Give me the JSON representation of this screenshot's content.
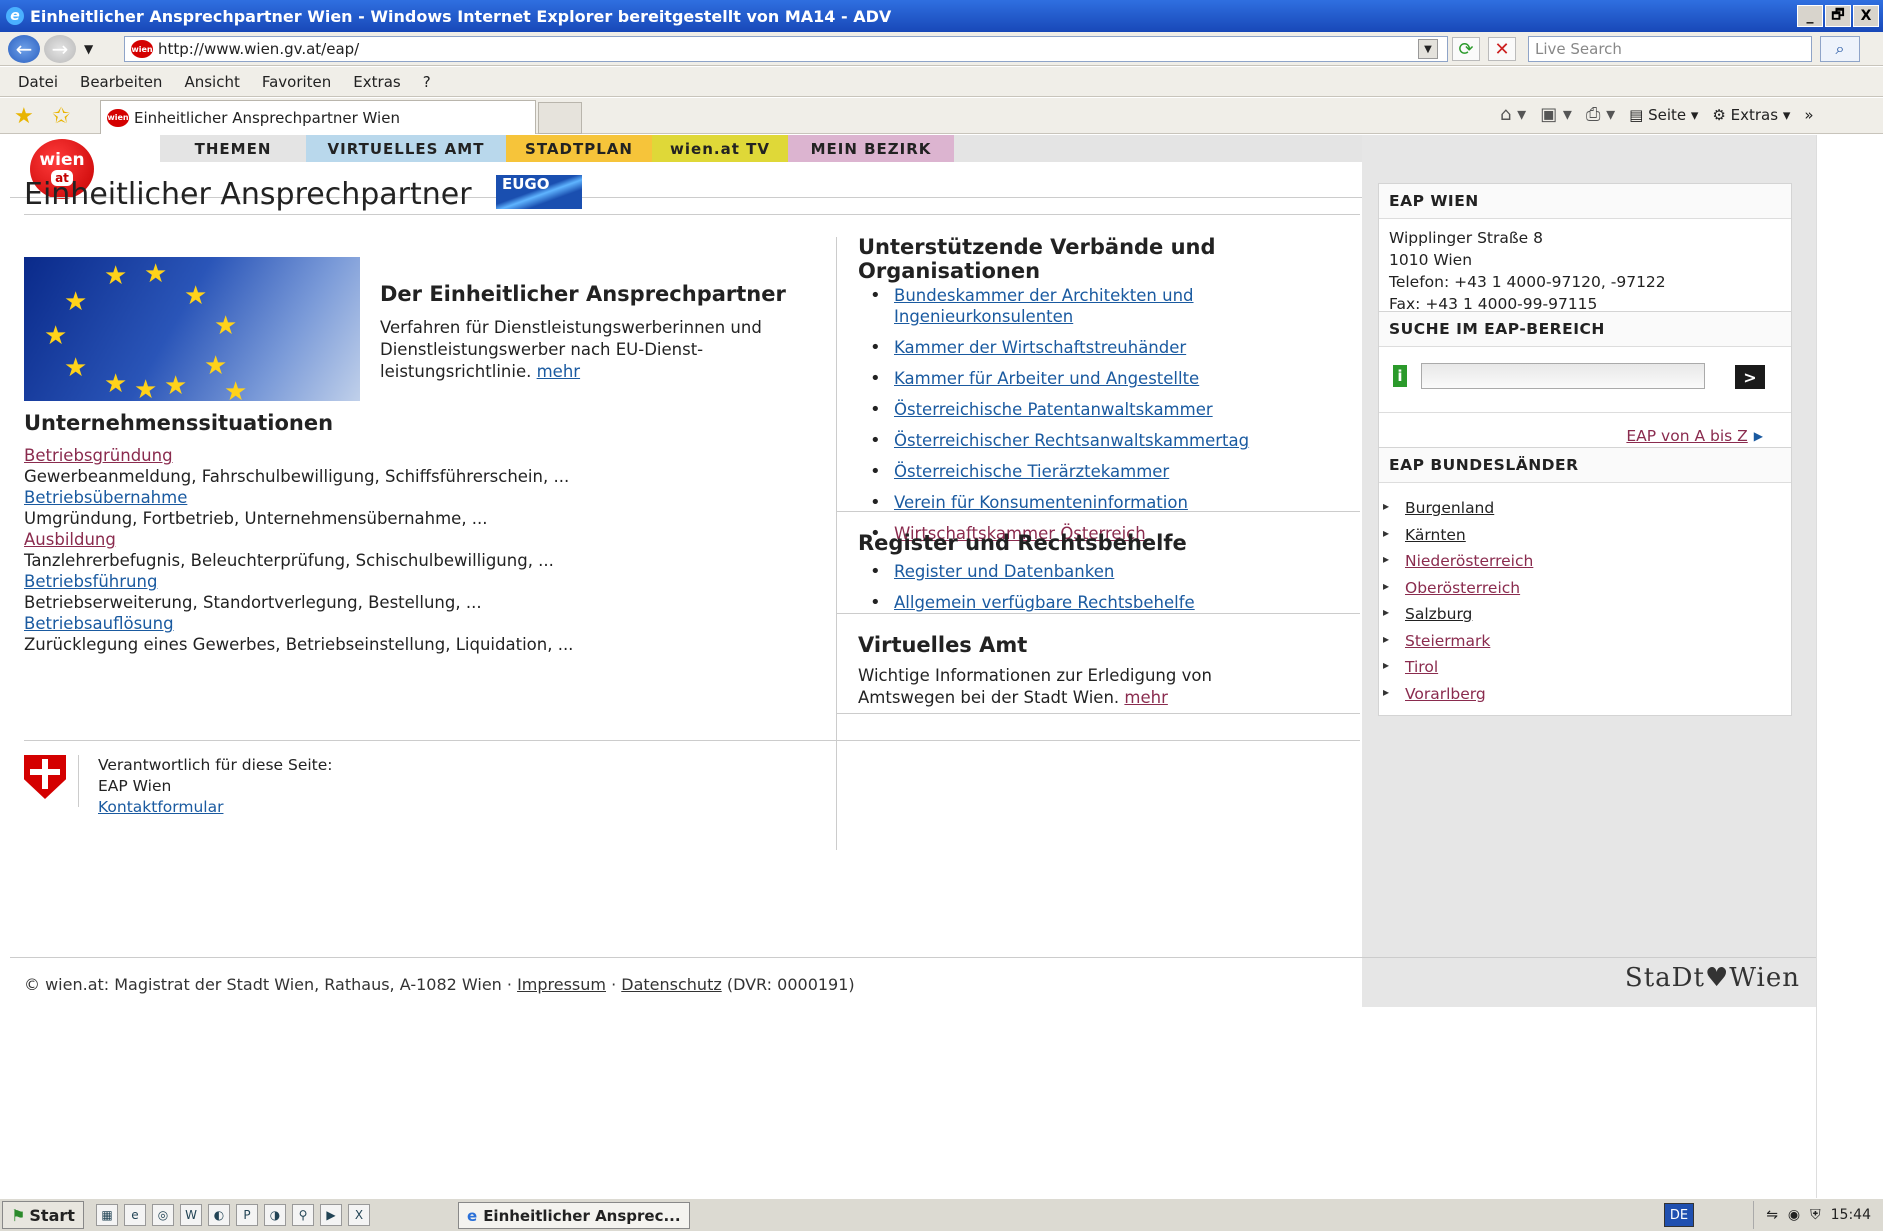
{
  "window": {
    "title": "Einheitlicher Ansprechpartner Wien - Windows Internet Explorer bereitgestellt von MA14 - ADV",
    "minimize": "_",
    "maximize": "🗗",
    "close": "X"
  },
  "browser": {
    "url": "http://www.wien.gv.at/eap/",
    "search_placeholder": "Live Search",
    "menu": [
      "Datei",
      "Bearbeiten",
      "Ansicht",
      "Favoriten",
      "Extras",
      "?"
    ],
    "tab_title": "Einheitlicher Ansprechpartner Wien",
    "cmd": {
      "page": "Seite",
      "extras": "Extras"
    }
  },
  "site": {
    "logo_top": "wien",
    "logo_bottom": "at",
    "nav": [
      {
        "label": "THEMEN",
        "color": "#e4e4e4"
      },
      {
        "label": "VIRTUELLES AMT",
        "color": "#b9d8ec"
      },
      {
        "label": "STADTPLAN",
        "color": "#f6c43a"
      },
      {
        "label": "wien.at TV",
        "color": "#dfd838"
      },
      {
        "label": "MEIN BEZIRK",
        "color": "#dcb4d0"
      }
    ]
  },
  "main": {
    "title": "Einheitlicher Ansprechpartner",
    "badge": "EUGO",
    "intro": {
      "heading": "Der Einheitlicher Ansprechpartner",
      "text": "Verfahren für Dienstleistungswerberinnen und Dienstleistungswerber nach EU-Dienst-leistungsrichtlinie.",
      "more": "mehr"
    },
    "situations_heading": "Unternehmenssituationen",
    "situations": [
      {
        "link": "Betriebsgründung",
        "desc": "Gewerbeanmeldung, Fahrschulbewilligung, Schiffsführerschein, ..."
      },
      {
        "link": "Betriebsübernahme",
        "desc": "Umgründung, Fortbetrieb, Unternehmensübernahme, ..."
      },
      {
        "link": "Ausbildung",
        "desc": "Tanzlehrerbefugnis, Beleuchterprüfung, Schischulbewilligung, ..."
      },
      {
        "link": "Betriebsführung",
        "desc": "Betriebserweiterung, Standortverlegung, Bestellung, ..."
      },
      {
        "link": "Betriebsauflösung",
        "desc": "Zurücklegung eines Gewerbes, Betriebseinstellung, Liquidation, ..."
      }
    ],
    "verbaende": {
      "heading": "Unterstützende Verbände und Organisationen",
      "items": [
        "Bundeskammer der Architekten und Ingenieurkonsulenten",
        "Kammer der Wirtschaftstreuhänder",
        "Kammer für Arbeiter und Angestellte",
        "Österreichische Patentanwaltskammer",
        "Österreichischer Rechtsanwaltskammertag",
        "Österreichische Tierärztekammer",
        "Verein für Konsumenteninformation",
        "Wirtschaftskammer Österreich"
      ]
    },
    "register": {
      "heading": "Register und Rechtsbehelfe",
      "items": [
        "Register und Datenbanken",
        "Allgemein verfügbare Rechtsbehelfe"
      ]
    },
    "virtuelles_amt": {
      "heading": "Virtuelles Amt",
      "text": "Wichtige Informationen zur Erledigung von Amtswegen bei der Stadt Wien.",
      "more": "mehr"
    },
    "responsible": {
      "label": "Verantwortlich für diese Seite:",
      "name": "EAP Wien",
      "contact": "Kontaktformular"
    }
  },
  "sidebar": {
    "eap_wien": {
      "heading": "EAP WIEN",
      "street": "Wipplinger Straße 8",
      "city": "1010 Wien",
      "phone": "Telefon: +43 1 4000-97120, -97122",
      "fax": "Fax: +43 1 4000-99-97115"
    },
    "search": {
      "heading": "SUCHE IM EAP-BEREICH",
      "go": ">",
      "atoz": "EAP von A bis Z"
    },
    "bundeslaender": {
      "heading": "EAP BUNDESLÄNDER",
      "items": [
        "Burgenland",
        "Kärnten",
        "Niederösterreich",
        "Oberösterreich",
        "Salzburg",
        "Steiermark",
        "Tirol",
        "Vorarlberg"
      ]
    }
  },
  "footer": {
    "copyright": "© wien.at: Magistrat der Stadt Wien, Rathaus, A-1082 Wien ·",
    "impressum": "Impressum",
    "datenschutz": "Datenschutz",
    "dvr": "(DVR: 0000191)",
    "brand": "StaDt♥Wien"
  },
  "taskbar": {
    "start": "Start",
    "task": "Einheitlicher Ansprec...",
    "lang": "DE",
    "clock": "15:44"
  }
}
